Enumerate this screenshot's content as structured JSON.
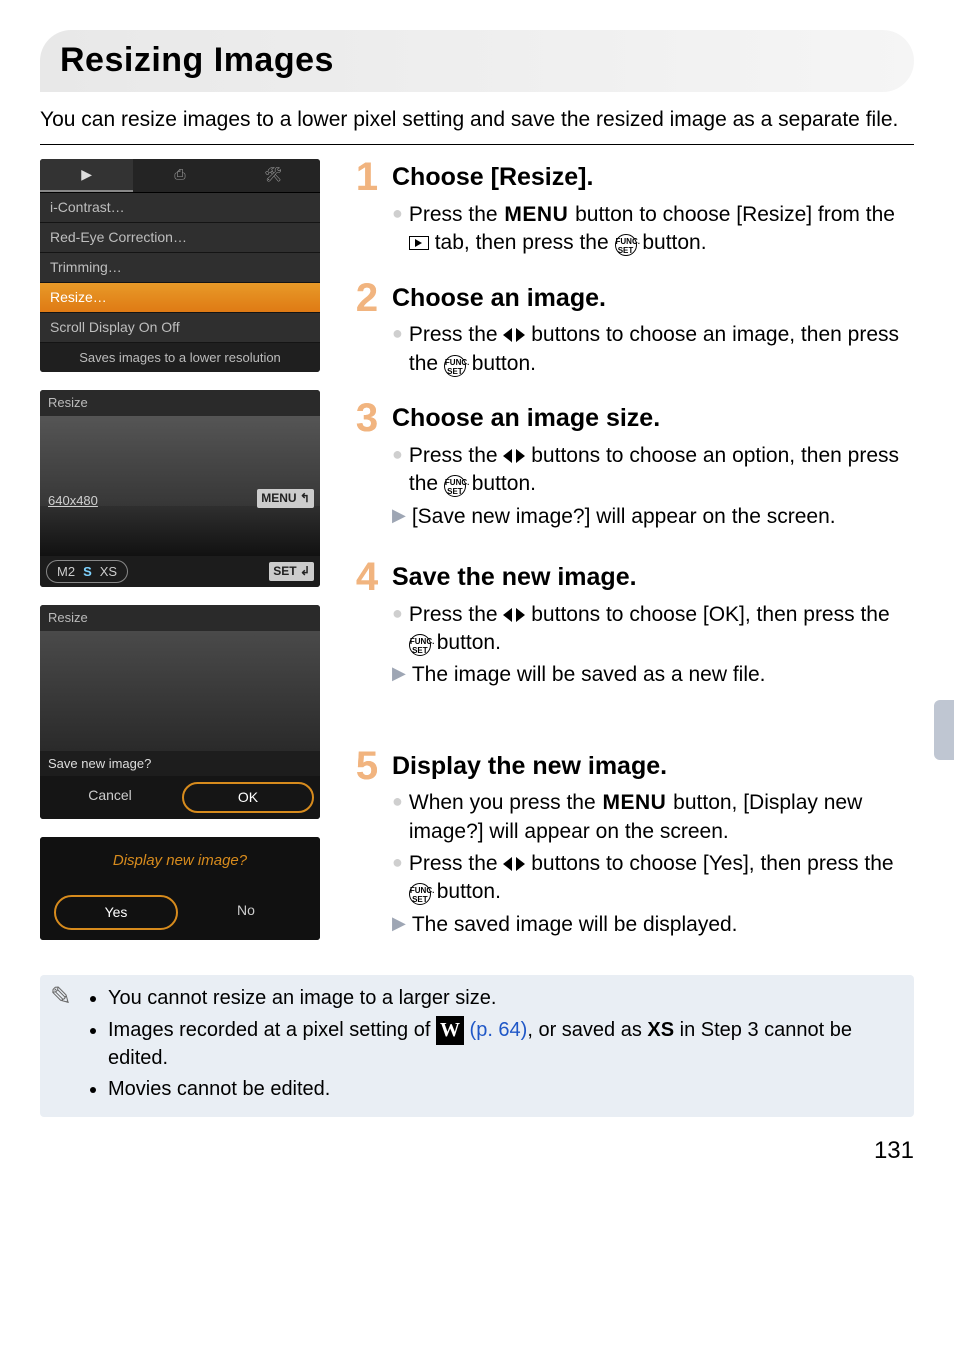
{
  "title_bar": {
    "heading": "Resizing Images"
  },
  "intro": "You can resize images to a lower pixel setting and save the resized image as a separate file.",
  "steps": [
    {
      "num": "1",
      "title": "Choose [Resize].",
      "items": [
        {
          "pre": "Press the ",
          "mid1": "[Resize] from the ",
          "mid2": " tab, then press the ",
          "tail": " button.",
          "full_a": " button to choose"
        }
      ]
    },
    {
      "num": "2",
      "title": "Choose an image.",
      "items": [
        {
          "pre": "Press the ",
          "mid": " buttons to choose an image, then press the ",
          "tail": " button."
        }
      ]
    },
    {
      "num": "3",
      "title": "Choose an image size.",
      "items": [
        {
          "pre": "Press the ",
          "mid": " buttons to choose an option, then press the ",
          "tail": " button."
        },
        {
          "result": "[Save new image?] will appear on the screen."
        }
      ]
    },
    {
      "num": "4",
      "title": "Save the new image.",
      "items": [
        {
          "pre": "Press the ",
          "mid": " buttons to choose [OK], then press the ",
          "tail": " button."
        },
        {
          "result": "The image will be saved as a new file."
        }
      ]
    },
    {
      "num": "5",
      "title": "Display the new image.",
      "items": [
        {
          "pre": "When you press the ",
          "mid": " button, [Display new image?] will appear on the screen."
        },
        {
          "pre2": "Press the ",
          "mid2": " buttons to choose [Yes], then press the ",
          "tail2": " button."
        },
        {
          "result": "The saved image will be displayed."
        }
      ]
    }
  ],
  "mock1": {
    "tabs": [
      "▶",
      "⎙",
      "🛠"
    ],
    "items": [
      "i-Contrast…",
      "Red-Eye Correction…",
      "Trimming…",
      "Resize…",
      "Scroll Display        On  Off"
    ],
    "status": "Saves images to a lower resolution"
  },
  "mock2": {
    "top": "Resize",
    "size_label": "640x480",
    "menu_label": "MENU ↰",
    "pill": {
      "a": "M2",
      "b": "S",
      "c": "XS"
    },
    "set_label": "SET ↲"
  },
  "mock3": {
    "top": "Resize",
    "question": "Save new image?",
    "cancel": "Cancel",
    "ok": "OK"
  },
  "mock4": {
    "msg": "Display new image?",
    "yes": "Yes",
    "no": "No"
  },
  "notes": {
    "n1": "You cannot resize an image to a larger size.",
    "n2a": "Images recorded at a pixel setting of ",
    "n2link": "(p. 64)",
    "n2b": ", or saved as ",
    "n2c": " in Step 3 cannot be edited.",
    "n3": "Movies cannot be edited."
  },
  "page_number": "131",
  "icon_text": {
    "menu": "MENU",
    "func": "FUNC.\nSET",
    "xs": "XS",
    "w": "W"
  }
}
